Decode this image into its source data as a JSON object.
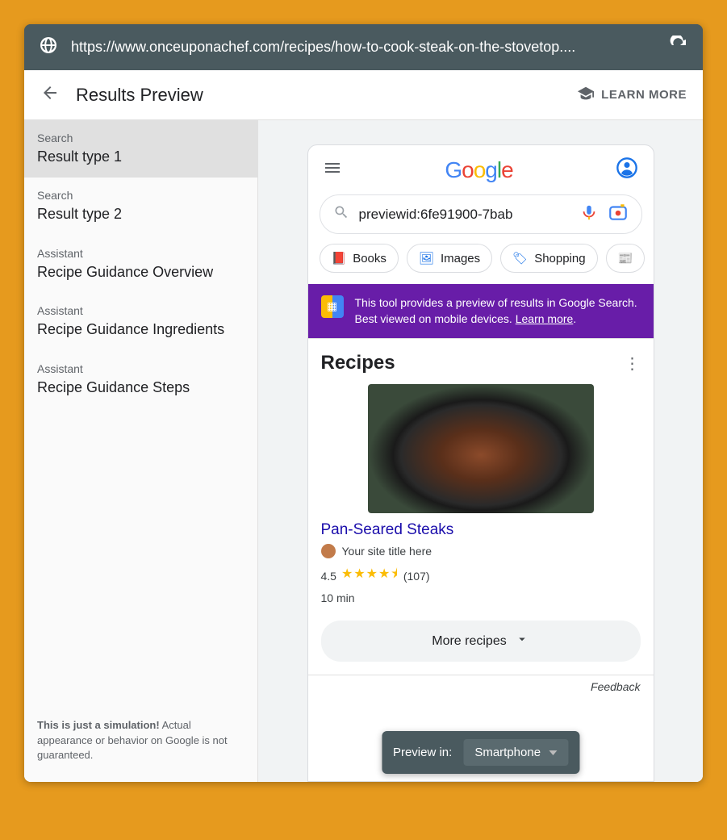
{
  "urlbar": {
    "url": "https://www.onceuponachef.com/recipes/how-to-cook-steak-on-the-stovetop...."
  },
  "header": {
    "title": "Results Preview",
    "learn_more": "LEARN MORE"
  },
  "sidebar": {
    "items": [
      {
        "category": "Search",
        "label": "Result type 1",
        "active": true
      },
      {
        "category": "Search",
        "label": "Result type 2",
        "active": false
      },
      {
        "category": "Assistant",
        "label": "Recipe Guidance Overview",
        "active": false
      },
      {
        "category": "Assistant",
        "label": "Recipe Guidance Ingredients",
        "active": false
      },
      {
        "category": "Assistant",
        "label": "Recipe Guidance Steps",
        "active": false
      }
    ],
    "footer": {
      "bold": "This is just a simulation!",
      "rest": " Actual appearance or behavior on Google is not guaranteed."
    }
  },
  "search": {
    "value": "previewid:6fe91900-7bab"
  },
  "chips": [
    {
      "label": "Books",
      "color": "#1a73e8"
    },
    {
      "label": "Images",
      "color": "#1a73e8"
    },
    {
      "label": "Shopping",
      "color": "#1a73e8"
    }
  ],
  "banner": {
    "text": "This tool provides a preview of results in Google Search. Best viewed on mobile devices. ",
    "link": "Learn more",
    "suffix": "."
  },
  "card": {
    "section_title": "Recipes",
    "recipe_title": "Pan-Seared Steaks",
    "site_title": "Your site title here",
    "rating": "4.5",
    "stars": "★★★★⯨",
    "reviews": "(107)",
    "time": "10 min",
    "more": "More recipes"
  },
  "feedback": "Feedback",
  "preview_selector": {
    "label": "Preview in:",
    "value": "Smartphone"
  }
}
